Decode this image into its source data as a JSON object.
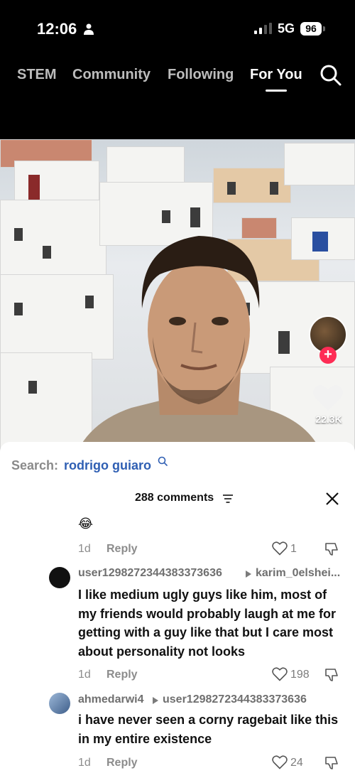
{
  "status_bar": {
    "time": "12:06",
    "network": "5G",
    "battery": "96"
  },
  "nav": {
    "tabs": [
      "STEM",
      "Community",
      "Following",
      "For You"
    ]
  },
  "video": {
    "like_count": "22.3K"
  },
  "search": {
    "prefix": "Search:",
    "term": "rodrigo guiaro"
  },
  "comments": {
    "count_label": "288 comments",
    "items": [
      {
        "text": "😂",
        "age": "1d",
        "reply_label": "Reply",
        "likes": "1"
      },
      {
        "user": "user1298272344383373636",
        "reply_to": "karim_0elshei...",
        "text": "I like medium ugly guys like him, most of my friends would probably laugh at me for getting with a guy like that but I care most about personality not looks",
        "age": "1d",
        "reply_label": "Reply",
        "likes": "198"
      },
      {
        "user": "ahmedarwi4",
        "reply_to": "user1298272344383373636",
        "text": "i have never seen a corny ragebait like this in my entire existence",
        "age": "1d",
        "reply_label": "Reply",
        "likes": "24"
      }
    ]
  }
}
